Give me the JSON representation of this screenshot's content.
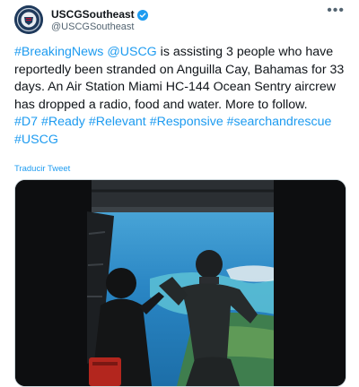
{
  "author": {
    "display_name": "USCGSoutheast",
    "handle": "@USCGSoutheast",
    "avatar_icon": "uscg-seal-icon",
    "verified_icon": "verified-badge-icon",
    "verified_color": "#1d9bf0"
  },
  "menu": {
    "more_label": "•••"
  },
  "tweet": {
    "line1_hashtag": "#BreakingNews",
    "line1_mention": "@USCG",
    "line1_rest": " is assisting 3 people who have reportedly been stranded on Anguilla Cay, Bahamas for 33 days. An Air Station Miami HC-144 Ocean Sentry aircrew has dropped a radio, food and water. More to follow.",
    "hashtags": [
      "#D7",
      "#Ready",
      "#Relevant",
      "#Responsive",
      "#searchandrescue",
      "#USCG"
    ]
  },
  "translate_label": "Traducir Tweet",
  "colors": {
    "link": "#1d9bf0",
    "text": "#0f1419",
    "secondary": "#536471"
  }
}
